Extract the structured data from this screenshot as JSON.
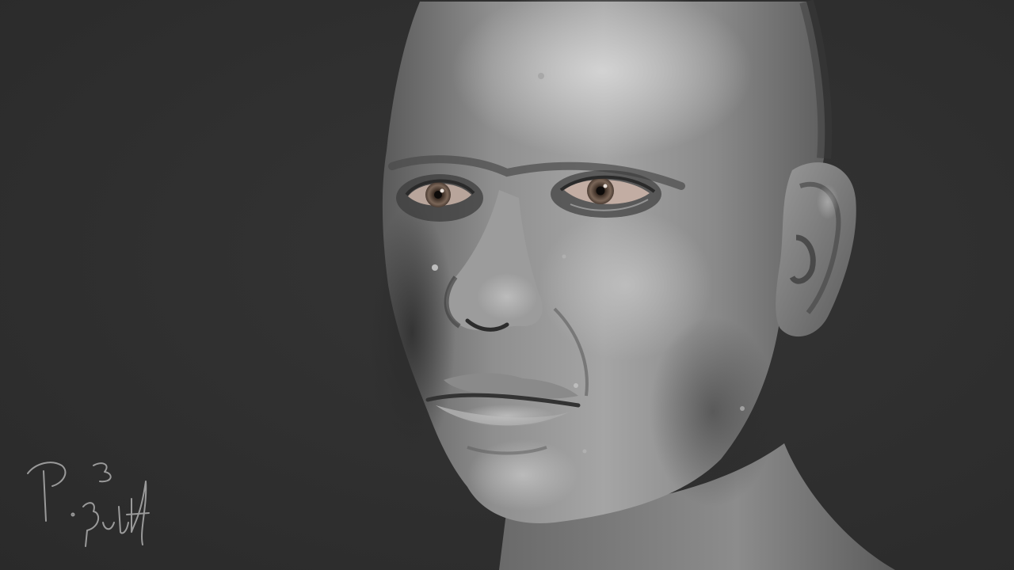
{
  "scene": {
    "subject": "sculpted-male-head-render",
    "background_color": "#2f2f2f",
    "skin_base_color": "#8f8f8f",
    "skin_highlight_color": "#d6d6d6",
    "skin_shadow_color": "#3a3a3a",
    "iris_color": "#7a6658",
    "eye_white_color": "#c9b5ab",
    "signature_color": "#9a9a9a",
    "signature_text": "P. 3 Butt"
  }
}
